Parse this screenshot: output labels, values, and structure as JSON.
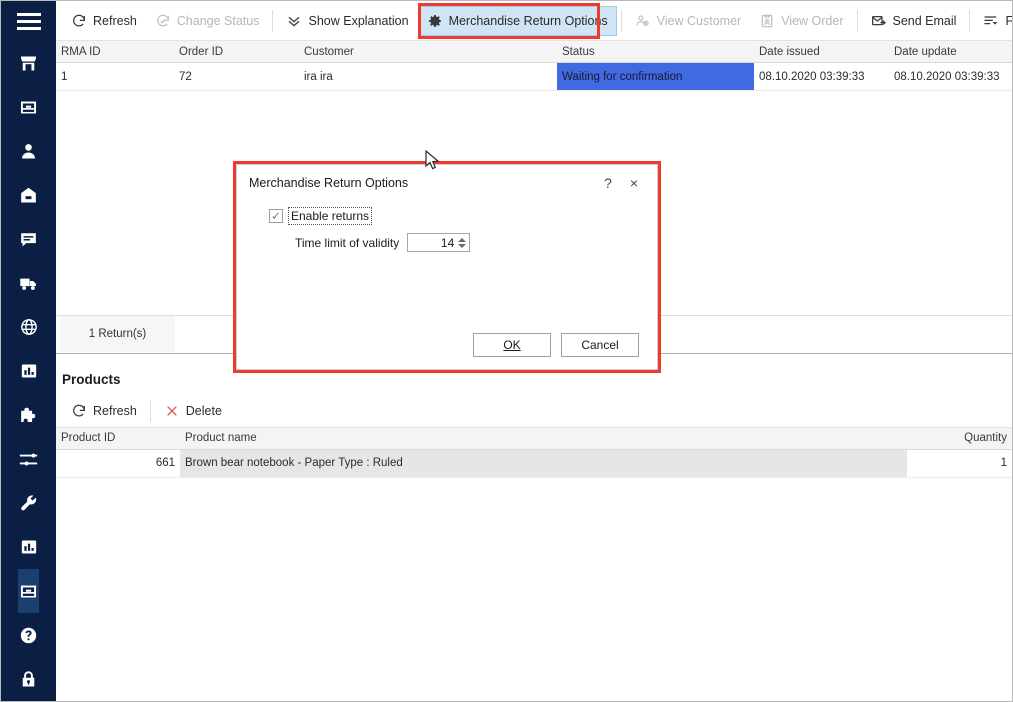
{
  "sidebar": {
    "menu_icon": "hamburger-menu-icon",
    "items": [
      {
        "icon": "storefront-icon",
        "name": "storefront",
        "active": false
      },
      {
        "icon": "inbox-icon",
        "name": "orders",
        "active": false
      },
      {
        "icon": "user-icon",
        "name": "customers",
        "active": false
      },
      {
        "icon": "basket-icon",
        "name": "products",
        "active": false
      },
      {
        "icon": "chat-icon",
        "name": "messages",
        "active": false
      },
      {
        "icon": "truck-icon",
        "name": "shipping",
        "active": false
      },
      {
        "icon": "globe-icon",
        "name": "web",
        "active": false
      },
      {
        "icon": "bar-chart-icon",
        "name": "reports",
        "active": false
      },
      {
        "icon": "puzzle-icon",
        "name": "plugins",
        "active": false
      },
      {
        "icon": "sliders-icon",
        "name": "settings",
        "active": false
      },
      {
        "icon": "wrench-icon",
        "name": "tools",
        "active": false
      },
      {
        "icon": "bar-chart-icon",
        "name": "statistics",
        "active": false
      },
      {
        "icon": "inbox-icon",
        "name": "returns",
        "active": true
      },
      {
        "icon": "help-icon",
        "name": "help",
        "active": false
      },
      {
        "icon": "lock-icon",
        "name": "security",
        "active": false
      }
    ]
  },
  "toolbar": {
    "buttons": [
      {
        "label": "Refresh",
        "icon": "refresh-icon",
        "state": "enabled"
      },
      {
        "label": "Change Status",
        "icon": "change-status-icon",
        "state": "disabled"
      },
      {
        "label": "Show Explanation",
        "icon": "chevron-double-down-icon",
        "state": "enabled"
      },
      {
        "label": "Merchandise Return Options",
        "icon": "gear-icon",
        "state": "highlight"
      },
      {
        "label": "View Customer",
        "icon": "view-customer-icon",
        "state": "disabled"
      },
      {
        "label": "View Order",
        "icon": "view-order-icon",
        "state": "disabled"
      },
      {
        "label": "Send Email",
        "icon": "send-email-icon",
        "state": "enabled"
      },
      {
        "label": "Filter Row",
        "icon": "filter-row-icon",
        "state": "enabled"
      }
    ]
  },
  "returns_grid": {
    "columns": [
      "RMA ID",
      "Order ID",
      "Customer",
      "Status",
      "Date issued",
      "Date update"
    ],
    "rows": [
      {
        "rma_id": "1",
        "order_id": "72",
        "customer": "ira ira",
        "status": "Waiting for confirmation",
        "date_issued": "08.10.2020 03:39:33",
        "date_update": "08.10.2020 03:39:33"
      }
    ],
    "footer": "1 Return(s)"
  },
  "products_panel": {
    "title": "Products",
    "toolbar": [
      {
        "label": "Refresh",
        "icon": "refresh-icon",
        "state": "enabled"
      },
      {
        "label": "Delete",
        "icon": "delete-x-icon",
        "state": "enabled"
      }
    ],
    "columns": [
      "Product ID",
      "Product name",
      "Quantity"
    ],
    "rows": [
      {
        "product_id": "661",
        "product_name": "Brown bear notebook - Paper Type : Ruled",
        "quantity": "1"
      }
    ]
  },
  "dialog": {
    "title": "Merchandise Return Options",
    "help_label": "?",
    "close_label": "×",
    "enable_returns_label": "Enable returns",
    "enable_returns_checked": true,
    "checkmark": "✓",
    "time_limit_label": "Time limit of validity",
    "time_limit_value": "14",
    "ok_label": "OK",
    "cancel_label": "Cancel"
  },
  "colors": {
    "sidebar_bg": "#0b1f44",
    "sidebar_active": "#1b4070",
    "status_selected_bg": "#4169e1",
    "annotation_red": "#ef3a2d",
    "highlight_blue": "#cfe5f5",
    "delete_red": "#e05a4f"
  }
}
